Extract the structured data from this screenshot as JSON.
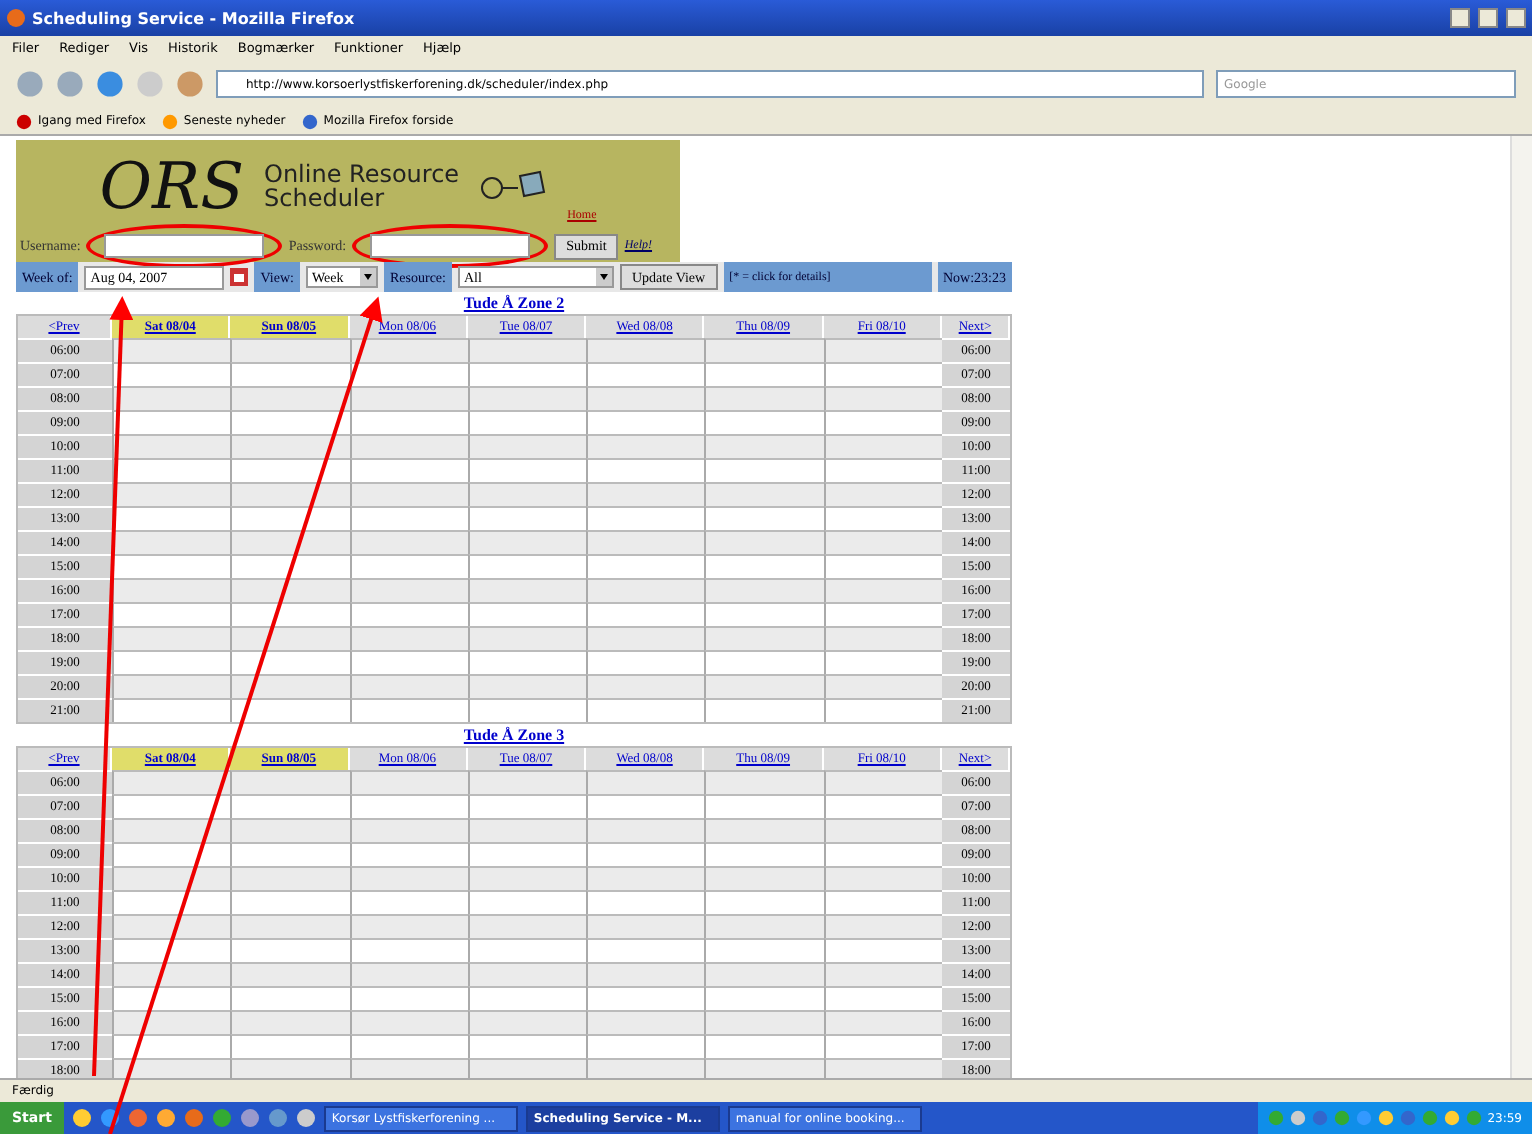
{
  "window": {
    "title": "Scheduling Service - Mozilla Firefox"
  },
  "menu": [
    "Filer",
    "Rediger",
    "Vis",
    "Historik",
    "Bogmærker",
    "Funktioner",
    "Hjælp"
  ],
  "navigation": {
    "url": "http://www.korsoerlystfiskerforening.dk/scheduler/index.php",
    "search_placeholder": "Google"
  },
  "bookmarks": [
    "Igang med Firefox",
    "Seneste nyheder",
    "Mozilla Firefox forside"
  ],
  "banner": {
    "logo": "ORS",
    "title_line_1": "Online Resource",
    "title_line_2": "Scheduler",
    "home_link": "Home"
  },
  "login": {
    "username_label": "Username:",
    "password_label": "Password:",
    "submit": "Submit",
    "help_link": "Help!"
  },
  "toolbar": {
    "week_label": "Week of:",
    "week_value": "Aug 04, 2007",
    "view_label": "View:",
    "view_value": "Week",
    "resource_label": "Resource:",
    "resource_value": "All",
    "update_button": "Update View",
    "hint": "[* = click for details]",
    "now": "Now:23:23"
  },
  "zones": [
    {
      "title": "Tude Å Zone 2",
      "prev": "<Prev",
      "next": "Next>",
      "days": [
        {
          "label": "Sat 08/04",
          "selected": true
        },
        {
          "label": "Sun 08/05",
          "selected": true
        },
        {
          "label": "Mon 08/06",
          "selected": false
        },
        {
          "label": "Tue 08/07",
          "selected": false
        },
        {
          "label": "Wed 08/08",
          "selected": false
        },
        {
          "label": "Thu 08/09",
          "selected": false
        },
        {
          "label": "Fri 08/10",
          "selected": false
        }
      ],
      "rows": [
        {
          "time_left": "06:00",
          "time_right": "06:00"
        },
        {
          "time_left": "07:00",
          "time_right": "07:00"
        },
        {
          "time_left": "08:00",
          "time_right": "08:00"
        },
        {
          "time_left": "09:00",
          "time_right": "09:00"
        },
        {
          "time_left": "10:00",
          "time_right": "10:00"
        },
        {
          "time_left": "11:00",
          "time_right": "11:00"
        },
        {
          "time_left": "12:00",
          "time_right": "12:00"
        },
        {
          "time_left": "13:00",
          "time_right": "13:00"
        },
        {
          "time_left": "14:00",
          "time_right": "14:00"
        },
        {
          "time_left": "15:00",
          "time_right": "15:00"
        },
        {
          "time_left": "16:00",
          "time_right": "16:00"
        },
        {
          "time_left": "17:00",
          "time_right": "17:00"
        },
        {
          "time_left": "18:00",
          "time_right": "18:00"
        },
        {
          "time_left": "19:00",
          "time_right": "19:00"
        },
        {
          "time_left": "20:00",
          "time_right": "20:00"
        },
        {
          "time_left": "21:00",
          "time_right": "21:00"
        }
      ]
    },
    {
      "title": "Tude Å Zone 3",
      "prev": "<Prev",
      "next": "Next>",
      "days": [
        {
          "label": "Sat 08/04",
          "selected": true
        },
        {
          "label": "Sun 08/05",
          "selected": true
        },
        {
          "label": "Mon 08/06",
          "selected": false
        },
        {
          "label": "Tue 08/07",
          "selected": false
        },
        {
          "label": "Wed 08/08",
          "selected": false
        },
        {
          "label": "Thu 08/09",
          "selected": false
        },
        {
          "label": "Fri 08/10",
          "selected": false
        }
      ],
      "rows": [
        {
          "time_left": "06:00",
          "time_right": "06:00"
        },
        {
          "time_left": "07:00",
          "time_right": "07:00"
        },
        {
          "time_left": "08:00",
          "time_right": "08:00"
        },
        {
          "time_left": "09:00",
          "time_right": "09:00"
        },
        {
          "time_left": "10:00",
          "time_right": "10:00"
        },
        {
          "time_left": "11:00",
          "time_right": "11:00"
        },
        {
          "time_left": "12:00",
          "time_right": "12:00"
        },
        {
          "time_left": "13:00",
          "time_right": "13:00"
        },
        {
          "time_left": "14:00",
          "time_right": "14:00"
        },
        {
          "time_left": "15:00",
          "time_right": "15:00"
        },
        {
          "time_left": "16:00",
          "time_right": "16:00"
        },
        {
          "time_left": "17:00",
          "time_right": "17:00"
        },
        {
          "time_left": "18:00",
          "time_right": "18:00"
        }
      ]
    }
  ],
  "status_bar": "Færdig",
  "taskbar": {
    "start": "Start",
    "tasks": [
      {
        "label": "Korsør Lystfiskerforening ...",
        "selected": false
      },
      {
        "label": "Scheduling Service - M...",
        "selected": true
      },
      {
        "label": "manual for online booking...",
        "selected": false
      }
    ],
    "clock": "23:59"
  }
}
